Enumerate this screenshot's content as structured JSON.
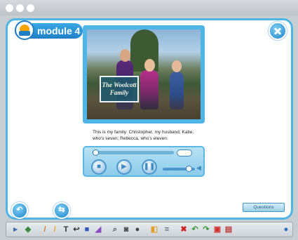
{
  "window": {
    "title": "module 4"
  },
  "video": {
    "caption_overlay": "The Woolcott Family",
    "subtitle": "This is my family: Christopher, my husband; Katie, who's seven; Rebecca, who's eleven.",
    "progress": 0.03,
    "volume": 0.8,
    "time_label": ""
  },
  "buttons": {
    "questions": "Questions"
  },
  "colors": {
    "accent": "#4fb4e6",
    "accent_dark": "#1f7fc6",
    "title_text": "#ffffff"
  },
  "icons": {
    "close": "close-icon",
    "back": "back-arrow-icon",
    "forward": "forward-arrow-icon",
    "stop": "stop-icon",
    "play": "play-icon",
    "pause": "pause-icon"
  },
  "toolbar": {
    "tools": [
      "cursor-icon",
      "eraser-icon",
      "pen-icon",
      "highlighter-icon",
      "text-icon",
      "curve-icon",
      "shape-icon",
      "fill-icon",
      "zoom-icon",
      "camera-icon",
      "spotlight-icon",
      "reveal-icon",
      "menu-icon",
      "delete-icon",
      "undo-icon",
      "redo-icon",
      "save-icon",
      "print-icon",
      "help-icon"
    ]
  }
}
